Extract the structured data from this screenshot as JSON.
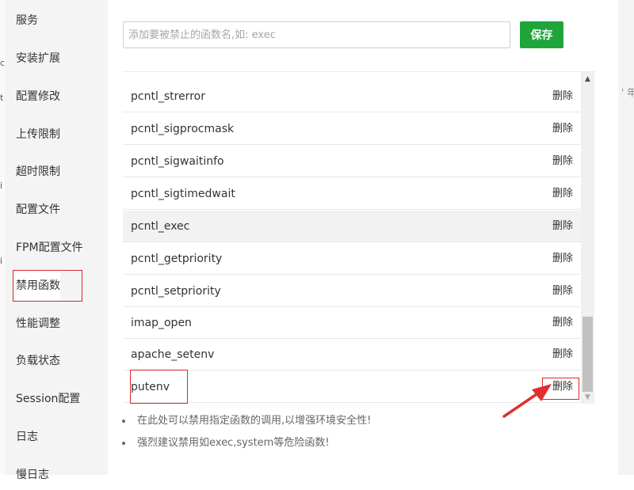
{
  "sidebar": {
    "items": [
      {
        "label": "服务"
      },
      {
        "label": "安装扩展"
      },
      {
        "label": "配置修改"
      },
      {
        "label": "上传限制"
      },
      {
        "label": "超时限制"
      },
      {
        "label": "配置文件"
      },
      {
        "label": "FPM配置文件"
      },
      {
        "label": "禁用函数",
        "active": true
      },
      {
        "label": "性能调整"
      },
      {
        "label": "负载状态"
      },
      {
        "label": "Session配置"
      },
      {
        "label": "日志"
      },
      {
        "label": "慢日志"
      }
    ]
  },
  "search": {
    "placeholder": "添加要被禁止的函数名,如: exec",
    "value": ""
  },
  "toolbar": {
    "save_label": "保存"
  },
  "table": {
    "delete_label": "删除",
    "rows": [
      {
        "name": "pcntl_strerror"
      },
      {
        "name": "pcntl_sigprocmask"
      },
      {
        "name": "pcntl_sigwaitinfo"
      },
      {
        "name": "pcntl_sigtimedwait"
      },
      {
        "name": "pcntl_exec",
        "highlighted": true
      },
      {
        "name": "pcntl_getpriority"
      },
      {
        "name": "pcntl_setpriority"
      },
      {
        "name": "imap_open"
      },
      {
        "name": "apache_setenv"
      },
      {
        "name": "putenv"
      }
    ]
  },
  "notes": [
    "在此处可以禁用指定函数的调用,以增强环境安全性!",
    "强烈建议禁用如exec,system等危险函数!"
  ],
  "background": {
    "left_marks": [
      "c",
      "t",
      "i",
      "i"
    ],
    "right_text": "' 年"
  },
  "colors": {
    "accent": "#20a53a",
    "annotation": "#d9292b",
    "sidebar_bg": "#f4f4f4",
    "row_highlight": "#f2f2f2"
  },
  "icons": {
    "scroll_up": "triangle-up-icon",
    "scroll_down": "triangle-down-icon",
    "annotation_arrow": "red-arrow-icon"
  }
}
